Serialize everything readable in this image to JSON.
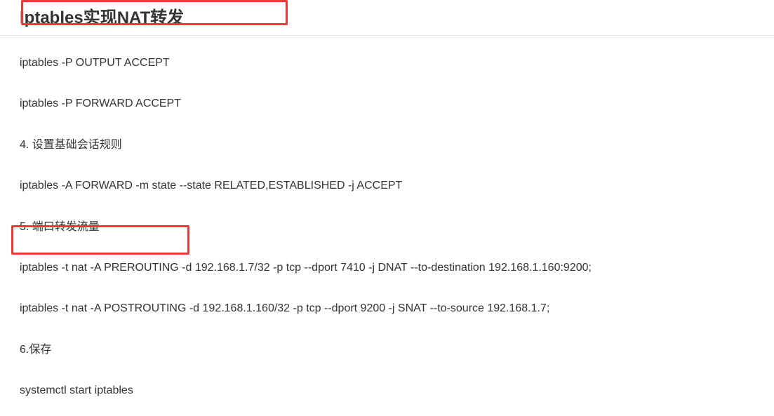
{
  "header": {
    "title": "Iptables实现NAT转发"
  },
  "content": {
    "lines": [
      "iptables -P OUTPUT ACCEPT",
      "iptables -P FORWARD ACCEPT",
      "4. 设置基础会话规则",
      "iptables -A FORWARD -m state --state RELATED,ESTABLISHED -j ACCEPT",
      "5. 端口转发流量",
      "iptables -t nat -A PREROUTING -d 192.168.1.7/32 -p tcp --dport 7410 -j DNAT --to-destination 192.168.1.160:9200;",
      "iptables -t nat -A POSTROUTING -d 192.168.1.160/32 -p tcp --dport 9200 -j SNAT --to-source 192.168.1.7;",
      "6.保存",
      "systemctl start iptables"
    ]
  }
}
